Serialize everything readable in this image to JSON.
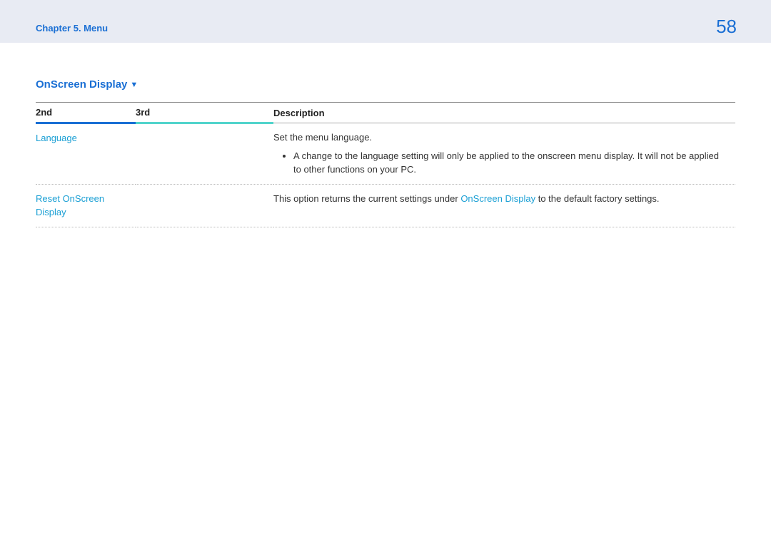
{
  "header": {
    "breadcrumb": "Chapter 5. Menu",
    "pageNumber": "58"
  },
  "section": {
    "title": "OnScreen Display"
  },
  "table": {
    "headers": {
      "col1": "2nd",
      "col2": "3rd",
      "col3": "Description"
    },
    "rows": [
      {
        "level2": "Language",
        "level3": "",
        "descMain": "Set the menu language.",
        "descBullet": "A change to the language setting will only be applied to the onscreen menu display. It will not be applied to other functions on your PC."
      },
      {
        "level2": "Reset OnScreen Display",
        "level3": "",
        "descPrefix": "This option returns the current settings under ",
        "descLink": "OnScreen Display",
        "descSuffix": " to the default factory settings."
      }
    ]
  }
}
